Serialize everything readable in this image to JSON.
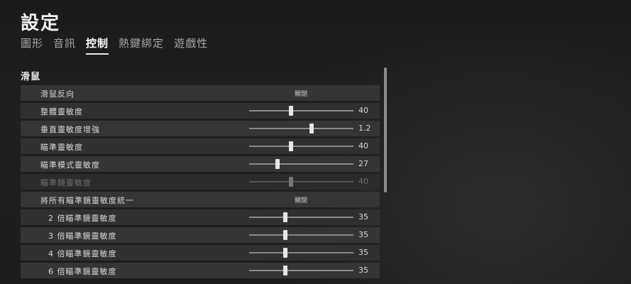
{
  "page": {
    "title": "設定"
  },
  "tabs": [
    {
      "label": "圖形",
      "active": false
    },
    {
      "label": "音訊",
      "active": false
    },
    {
      "label": "控制",
      "active": true
    },
    {
      "label": "熱鍵綁定",
      "active": false
    },
    {
      "label": "遊戲性",
      "active": false
    }
  ],
  "section": {
    "title": "滑鼠"
  },
  "settings": [
    {
      "label": "滑鼠反向",
      "type": "toggle",
      "value": "關閉"
    },
    {
      "label": "整體靈敏度",
      "type": "slider",
      "value": "40",
      "fraction": 0.4
    },
    {
      "label": "垂直靈敏度增強",
      "type": "slider",
      "value": "1.2",
      "fraction": 0.6
    },
    {
      "label": "瞄準靈敏度",
      "type": "slider",
      "value": "40",
      "fraction": 0.4
    },
    {
      "label": "瞄準模式靈敏度",
      "type": "slider",
      "value": "27",
      "fraction": 0.27
    },
    {
      "label": "瞄準鏡靈敏度",
      "type": "slider",
      "value": "40",
      "fraction": 0.4,
      "disabled": true
    },
    {
      "label": "將所有瞄準鏡靈敏度統一",
      "type": "toggle",
      "value": "關閉"
    },
    {
      "label": "2 倍瞄準鏡靈敏度",
      "type": "slider",
      "value": "35",
      "fraction": 0.35,
      "indent": true
    },
    {
      "label": "3 倍瞄準鏡靈敏度",
      "type": "slider",
      "value": "35",
      "fraction": 0.35,
      "indent": true
    },
    {
      "label": "4 倍瞄準鏡靈敏度",
      "type": "slider",
      "value": "35",
      "fraction": 0.35,
      "indent": true
    },
    {
      "label": "6 倍瞄準鏡靈敏度",
      "type": "slider",
      "value": "35",
      "fraction": 0.35,
      "indent": true
    }
  ],
  "colors": {
    "accent": "#e8e8e8",
    "row_bg": "#353535",
    "background": "#1d1d1d"
  }
}
